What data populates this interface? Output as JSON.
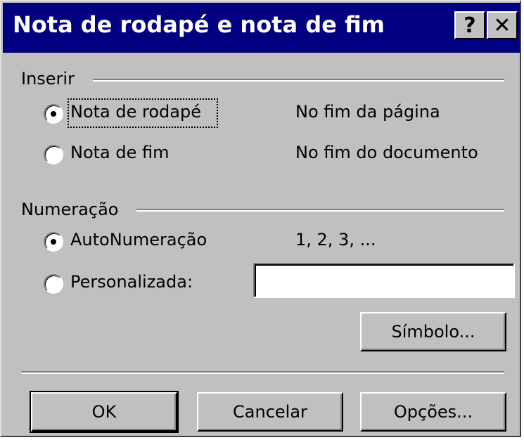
{
  "title": "Nota de rodapé e nota de fim",
  "title_buttons": {
    "help": "?",
    "close": "✕"
  },
  "inserir": {
    "group_label": "Inserir",
    "options": [
      {
        "label": "Nota de rodapé",
        "checked": true,
        "location": "No fim da página"
      },
      {
        "label": "Nota de fim",
        "checked": false,
        "location": "No fim do documento"
      }
    ]
  },
  "numeracao": {
    "group_label": "Numeração",
    "auto_label": "AutoNumeração",
    "auto_checked": true,
    "auto_preview": "1, 2, 3, ...",
    "custom_label": "Personalizada:",
    "custom_checked": false,
    "custom_value": ""
  },
  "buttons": {
    "symbol": "Símbolo...",
    "ok": "OK",
    "cancel": "Cancelar",
    "options": "Opções..."
  }
}
